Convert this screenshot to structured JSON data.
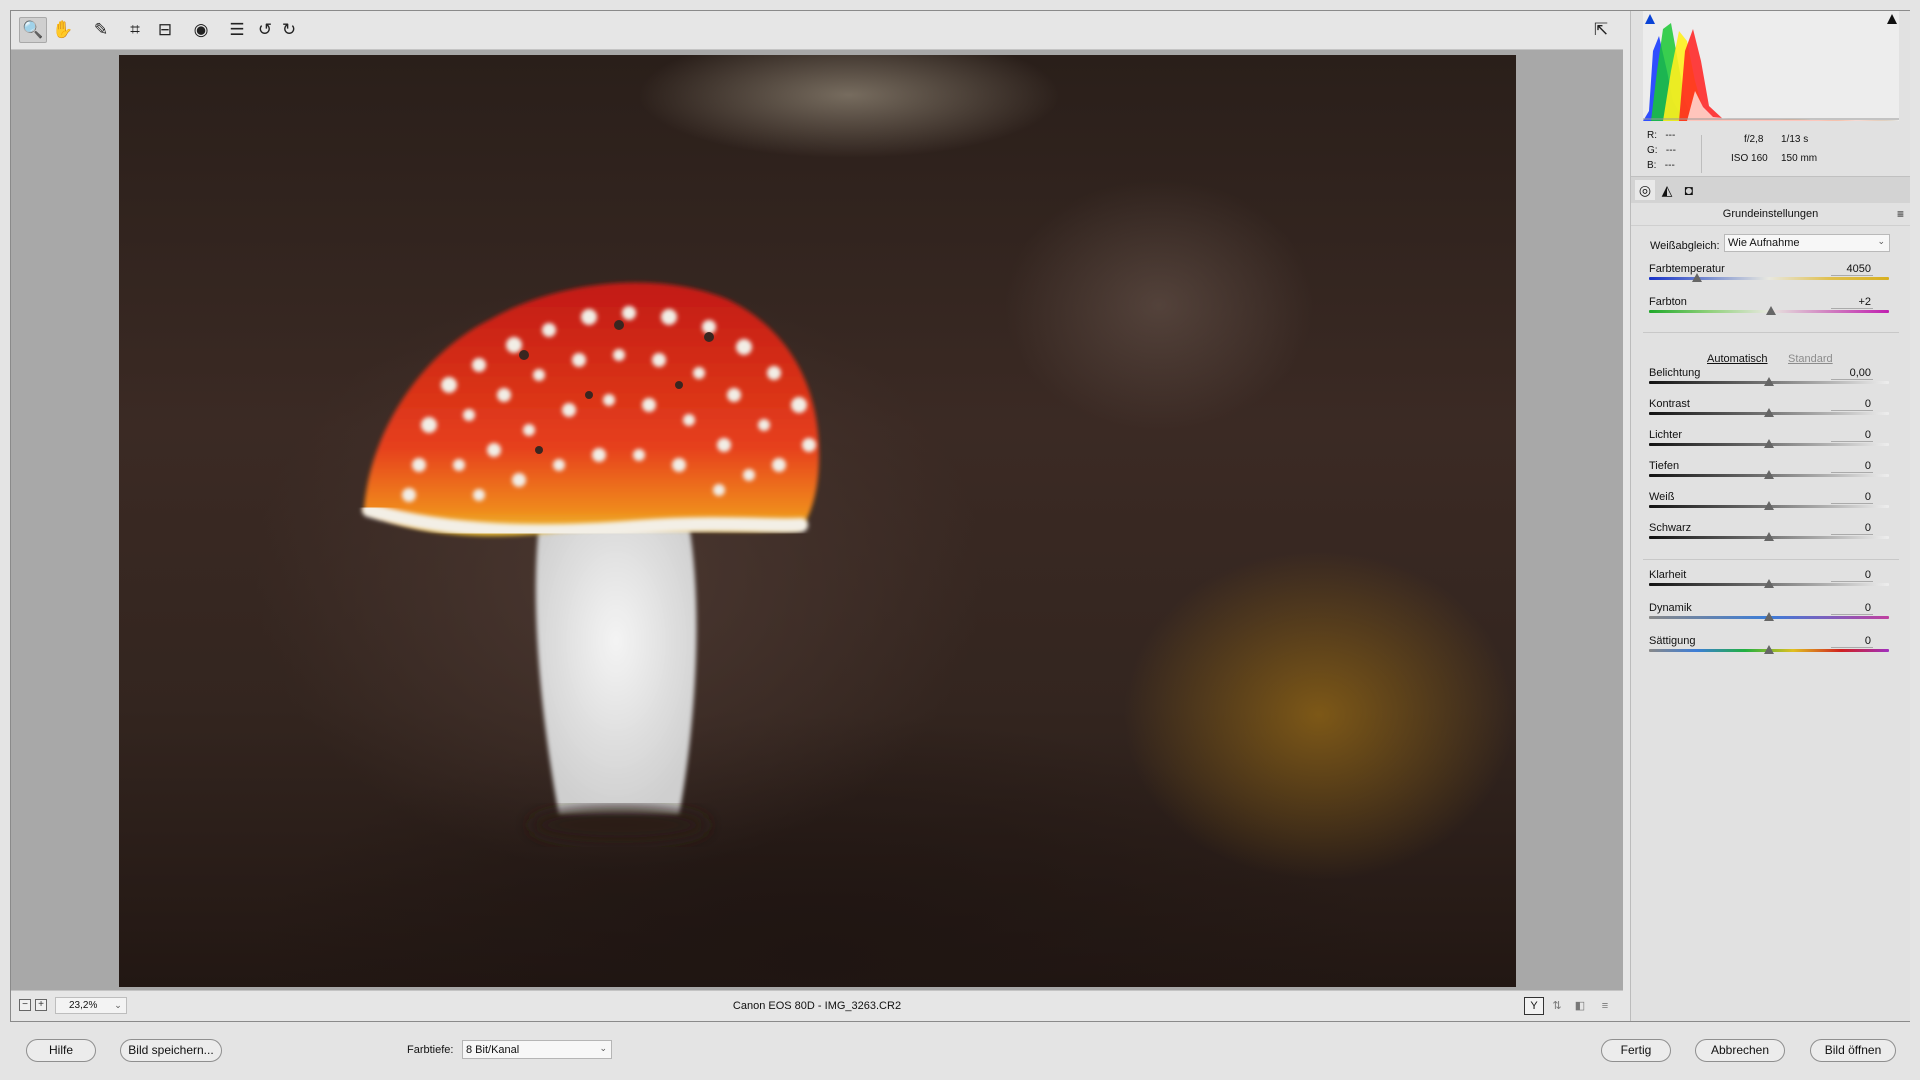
{
  "toolbar": {
    "tools": [
      "zoom-tool",
      "hand-tool",
      "white-balance-tool",
      "crop-tool",
      "straighten-tool",
      "red-eye-tool",
      "preferences-tool",
      "rotate-left-tool",
      "rotate-right-tool"
    ],
    "icons": {
      "zoom": "🔍",
      "hand": "✋",
      "wb": "✎",
      "crop": "⌗",
      "straighten": "⊟",
      "redeye": "◉",
      "prefs": "☰",
      "rotl": "↺",
      "rotr": "↻",
      "fullscreen": "⇱"
    }
  },
  "status": {
    "zoom_value": "23,2%",
    "zoom_out": "−",
    "zoom_in": "+",
    "caret": "⌄",
    "filename": "Canon EOS 80D  -  IMG_3263.CR2",
    "view_icons": [
      "Y",
      "⇅",
      "◧",
      "≡"
    ]
  },
  "panel": {
    "readout": {
      "r_label": "R:",
      "r_value": "---",
      "g_label": "G:",
      "g_value": "---",
      "b_label": "B:",
      "b_value": "---"
    },
    "camera": {
      "aperture": "f/2,8",
      "shutter": "1/13 s",
      "iso": "ISO 160",
      "focal": "150 mm"
    },
    "tab_icons": {
      "basic": "◎",
      "curve": "◭",
      "camera": "◘"
    },
    "section_title": "Grundeinstellungen",
    "menu_icon": "≡",
    "white_balance": {
      "label": "Weißabgleich:",
      "value": "Wie Aufnahme",
      "caret": "⌄"
    },
    "temperature": {
      "label": "Farbtemperatur",
      "value": "4050",
      "level": 0.2
    },
    "tint": {
      "label": "Farbton",
      "value": "+2",
      "level": 0.51
    },
    "auto_label": "Automatisch",
    "default_label": "Standard",
    "tone": [
      {
        "label": "Belichtung",
        "value": "0,00",
        "level": 0.5
      },
      {
        "label": "Kontrast",
        "value": "0",
        "level": 0.5
      },
      {
        "label": "Lichter",
        "value": "0",
        "level": 0.5
      },
      {
        "label": "Tiefen",
        "value": "0",
        "level": 0.5
      },
      {
        "label": "Weiß",
        "value": "0",
        "level": 0.5
      },
      {
        "label": "Schwarz",
        "value": "0",
        "level": 0.5
      }
    ],
    "presence": [
      {
        "label": "Klarheit",
        "value": "0",
        "level": 0.5
      },
      {
        "label": "Dynamik",
        "value": "0",
        "level": 0.5
      },
      {
        "label": "Sättigung",
        "value": "0",
        "level": 0.5
      }
    ]
  },
  "bottom": {
    "help": "Hilfe",
    "save": "Bild speichern...",
    "depth_label": "Farbtiefe:",
    "depth_value": "8 Bit/Kanal",
    "depth_caret": "⌄",
    "done": "Fertig",
    "cancel": "Abbrechen",
    "open": "Bild öffnen"
  },
  "colors": {
    "accent": "#0a43d6",
    "mushroom_red": "#d8321c"
  }
}
